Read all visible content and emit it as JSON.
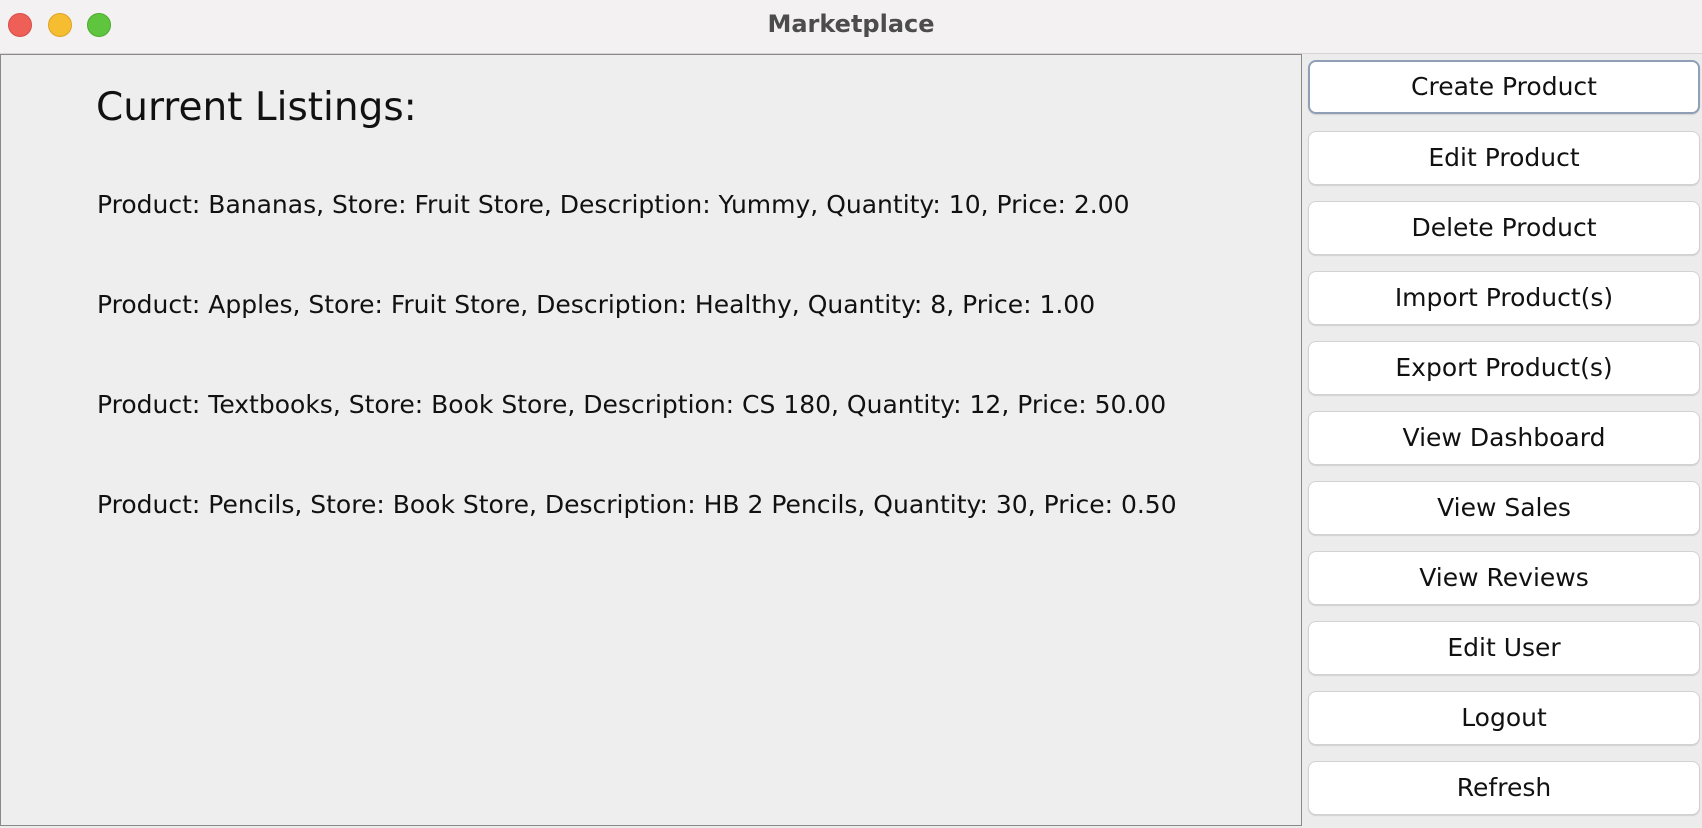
{
  "window": {
    "title": "Marketplace"
  },
  "main": {
    "heading": "Current Listings:",
    "listings": [
      "Product: Bananas, Store: Fruit Store, Description: Yummy, Quantity: 10, Price: 2.00",
      "Product: Apples, Store: Fruit Store, Description: Healthy, Quantity: 8, Price: 1.00",
      "Product: Textbooks, Store: Book Store, Description: CS 180, Quantity: 12, Price: 50.00",
      "Product: Pencils, Store: Book Store, Description: HB 2 Pencils, Quantity: 30, Price: 0.50"
    ]
  },
  "sidebar": {
    "buttons": [
      "Create Product",
      "Edit Product",
      "Delete Product",
      "Import Product(s)",
      "Export Product(s)",
      "View Dashboard",
      "View Sales",
      "View Reviews",
      "Edit User",
      "Logout",
      "Refresh"
    ]
  },
  "colors": {
    "close": "#ee5f58",
    "minimize": "#f5bd2f",
    "maximize": "#5fc53f",
    "focus_ring": "#8fa0b6"
  }
}
